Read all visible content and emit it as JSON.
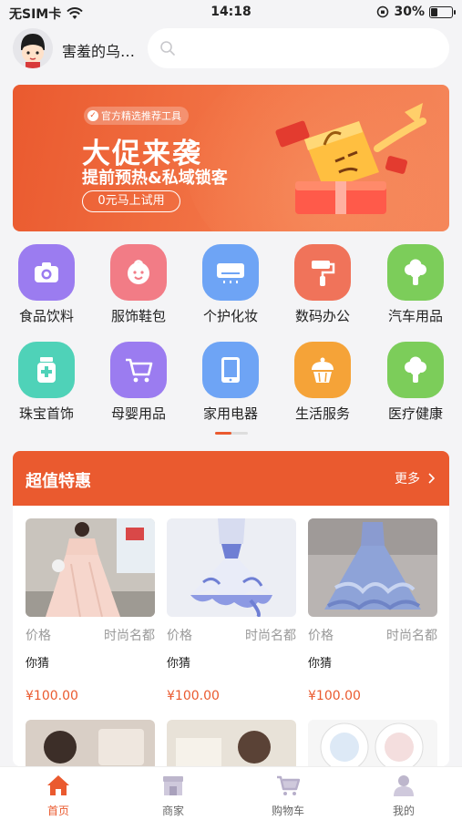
{
  "status": {
    "carrier": "无SIM卡",
    "time": "14:18",
    "battery": "30%",
    "battery_level": 0.3
  },
  "header": {
    "username": "害羞的乌…",
    "search_icon": "search-icon"
  },
  "banner": {
    "badge": "官方精选推荐工具",
    "title": "大促来袭",
    "subtitle": "提前预热&私域锁客",
    "button": "0元马上试用"
  },
  "categories": [
    {
      "label": "食品饮料",
      "icon": "camera-icon",
      "color": "#9b7cf0"
    },
    {
      "label": "服饰鞋包",
      "icon": "baby-face-icon",
      "color": "#f27c86"
    },
    {
      "label": "个护化妆",
      "icon": "air-conditioner-icon",
      "color": "#6ea4f5"
    },
    {
      "label": "数码办公",
      "icon": "paint-roller-icon",
      "color": "#f0735a"
    },
    {
      "label": "汽车用品",
      "icon": "broccoli-icon",
      "color": "#7ccd5a"
    },
    {
      "label": "珠宝首饰",
      "icon": "medicine-bottle-icon",
      "color": "#4fd2b8"
    },
    {
      "label": "母婴用品",
      "icon": "shopping-cart-icon",
      "color": "#9b7cf0"
    },
    {
      "label": "家用电器",
      "icon": "tablet-icon",
      "color": "#6ea4f5"
    },
    {
      "label": "生活服务",
      "icon": "cupcake-icon",
      "color": "#f5a338"
    },
    {
      "label": "医疗健康",
      "icon": "broccoli-icon",
      "color": "#7ccd5a"
    }
  ],
  "deals": {
    "title": "超值特惠",
    "more": "更多",
    "products": [
      {
        "price_label": "价格",
        "tag": "时尚名都",
        "name": "你猜",
        "price": "¥100.00"
      },
      {
        "price_label": "价格",
        "tag": "时尚名都",
        "name": "你猜",
        "price": "¥100.00"
      },
      {
        "price_label": "价格",
        "tag": "时尚名都",
        "name": "你猜",
        "price": "¥100.00"
      }
    ]
  },
  "tabs": [
    {
      "label": "首页",
      "icon": "home-icon",
      "active": true
    },
    {
      "label": "商家",
      "icon": "store-icon",
      "active": false
    },
    {
      "label": "购物车",
      "icon": "cart-icon",
      "active": false
    },
    {
      "label": "我的",
      "icon": "user-icon",
      "active": false
    }
  ],
  "colors": {
    "accent": "#ea5a2f",
    "background": "#f4f4f6"
  }
}
